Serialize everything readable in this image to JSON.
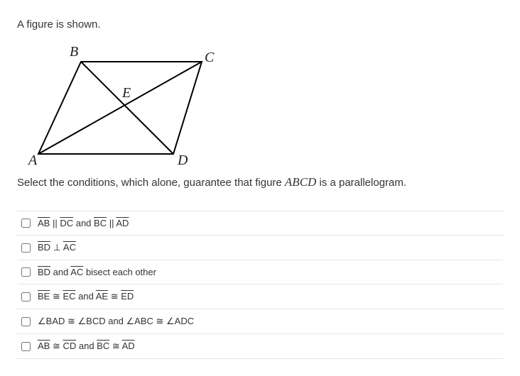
{
  "intro": "A figure is shown.",
  "figure": {
    "labels": {
      "A": "A",
      "B": "B",
      "C": "C",
      "D": "D",
      "E": "E"
    }
  },
  "prompt_pre": "Select the conditions, which alone, guarantee that figure  ",
  "prompt_abcd": "ABCD",
  "prompt_post": " is a parallelogram.",
  "options": [
    {
      "parts": [
        {
          "text": "AB",
          "seg": true
        },
        {
          "text": " || "
        },
        {
          "text": "DC",
          "seg": true
        },
        {
          "text": " and "
        },
        {
          "text": "BC",
          "seg": true
        },
        {
          "text": " || "
        },
        {
          "text": "AD",
          "seg": true
        }
      ]
    },
    {
      "parts": [
        {
          "text": "BD",
          "seg": true
        },
        {
          "text": " ⊥ "
        },
        {
          "text": "AC",
          "seg": true
        }
      ]
    },
    {
      "parts": [
        {
          "text": "BD",
          "seg": true
        },
        {
          "text": " and "
        },
        {
          "text": "AC",
          "seg": true
        },
        {
          "text": " bisect each other"
        }
      ]
    },
    {
      "parts": [
        {
          "text": "BE",
          "seg": true
        },
        {
          "text": " ≅ "
        },
        {
          "text": "EC",
          "seg": true
        },
        {
          "text": " and "
        },
        {
          "text": "AE",
          "seg": true
        },
        {
          "text": " ≅ "
        },
        {
          "text": "ED",
          "seg": true
        }
      ]
    },
    {
      "parts": [
        {
          "text": "∠BAD ≅ ∠BCD and ∠ABC ≅ ∠ADC"
        }
      ]
    },
    {
      "parts": [
        {
          "text": "AB",
          "seg": true
        },
        {
          "text": " ≅ "
        },
        {
          "text": "CD",
          "seg": true
        },
        {
          "text": " and "
        },
        {
          "text": "BC",
          "seg": true
        },
        {
          "text": " ≅ "
        },
        {
          "text": "AD",
          "seg": true
        }
      ]
    }
  ]
}
